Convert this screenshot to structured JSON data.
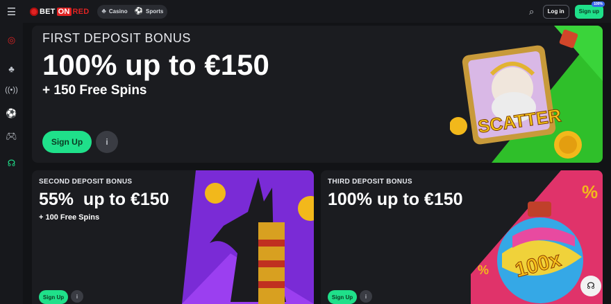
{
  "header": {
    "menu_icon": "hamburger-icon",
    "logo": {
      "part1": "BET",
      "part2": "ON",
      "part3": "RED"
    },
    "nav": [
      {
        "label": "Casino",
        "icon": "cherries-icon"
      },
      {
        "label": "Sports",
        "icon": "soccer-ball-icon"
      }
    ],
    "login_label": "Log in",
    "signup_label": "Sign up",
    "signup_badge": "100%"
  },
  "sidebar": {
    "icons": [
      "darts-icon",
      "cherries-icon",
      "live-broadcast-icon",
      "soccer-ball-icon",
      "gamepad-icon",
      "support-headset-icon"
    ]
  },
  "hero": {
    "kicker": "FIRST DEPOSIT BONUS",
    "title": "100% up to €150",
    "subtitle": "+ 150 Free Spins",
    "signup_label": "Sign Up",
    "art_text": "SCATTER",
    "colors": {
      "accent": "#1fe08a",
      "art_green": "#2fbf2a"
    }
  },
  "cards": [
    {
      "kicker": "SECOND DEPOSIT BONUS",
      "title": "55%  up to €150",
      "subtitle": "+ 100 Free Spins",
      "signup_label": "Sign Up",
      "art_color": "#7a2bd6"
    },
    {
      "kicker": "THIRD DEPOSIT BONUS",
      "title": "100% up to €150",
      "subtitle": "",
      "signup_label": "Sign Up",
      "art_color": "#e0336a",
      "art_text": "100x"
    }
  ]
}
